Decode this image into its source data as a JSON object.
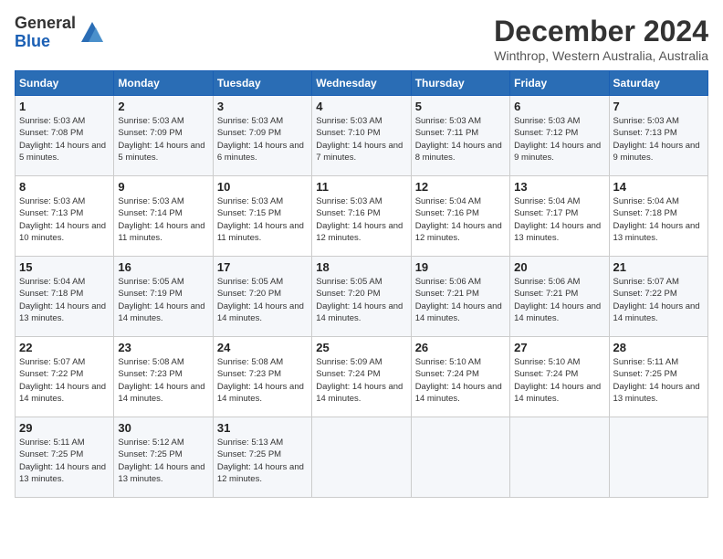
{
  "logo": {
    "general": "General",
    "blue": "Blue"
  },
  "title": "December 2024",
  "location": "Winthrop, Western Australia, Australia",
  "days_of_week": [
    "Sunday",
    "Monday",
    "Tuesday",
    "Wednesday",
    "Thursday",
    "Friday",
    "Saturday"
  ],
  "weeks": [
    [
      {
        "day": "1",
        "sunrise": "5:03 AM",
        "sunset": "7:08 PM",
        "daylight": "14 hours and 5 minutes."
      },
      {
        "day": "2",
        "sunrise": "5:03 AM",
        "sunset": "7:09 PM",
        "daylight": "14 hours and 5 minutes."
      },
      {
        "day": "3",
        "sunrise": "5:03 AM",
        "sunset": "7:09 PM",
        "daylight": "14 hours and 6 minutes."
      },
      {
        "day": "4",
        "sunrise": "5:03 AM",
        "sunset": "7:10 PM",
        "daylight": "14 hours and 7 minutes."
      },
      {
        "day": "5",
        "sunrise": "5:03 AM",
        "sunset": "7:11 PM",
        "daylight": "14 hours and 8 minutes."
      },
      {
        "day": "6",
        "sunrise": "5:03 AM",
        "sunset": "7:12 PM",
        "daylight": "14 hours and 9 minutes."
      },
      {
        "day": "7",
        "sunrise": "5:03 AM",
        "sunset": "7:13 PM",
        "daylight": "14 hours and 9 minutes."
      }
    ],
    [
      {
        "day": "8",
        "sunrise": "5:03 AM",
        "sunset": "7:13 PM",
        "daylight": "14 hours and 10 minutes."
      },
      {
        "day": "9",
        "sunrise": "5:03 AM",
        "sunset": "7:14 PM",
        "daylight": "14 hours and 11 minutes."
      },
      {
        "day": "10",
        "sunrise": "5:03 AM",
        "sunset": "7:15 PM",
        "daylight": "14 hours and 11 minutes."
      },
      {
        "day": "11",
        "sunrise": "5:03 AM",
        "sunset": "7:16 PM",
        "daylight": "14 hours and 12 minutes."
      },
      {
        "day": "12",
        "sunrise": "5:04 AM",
        "sunset": "7:16 PM",
        "daylight": "14 hours and 12 minutes."
      },
      {
        "day": "13",
        "sunrise": "5:04 AM",
        "sunset": "7:17 PM",
        "daylight": "14 hours and 13 minutes."
      },
      {
        "day": "14",
        "sunrise": "5:04 AM",
        "sunset": "7:18 PM",
        "daylight": "14 hours and 13 minutes."
      }
    ],
    [
      {
        "day": "15",
        "sunrise": "5:04 AM",
        "sunset": "7:18 PM",
        "daylight": "14 hours and 13 minutes."
      },
      {
        "day": "16",
        "sunrise": "5:05 AM",
        "sunset": "7:19 PM",
        "daylight": "14 hours and 14 minutes."
      },
      {
        "day": "17",
        "sunrise": "5:05 AM",
        "sunset": "7:20 PM",
        "daylight": "14 hours and 14 minutes."
      },
      {
        "day": "18",
        "sunrise": "5:05 AM",
        "sunset": "7:20 PM",
        "daylight": "14 hours and 14 minutes."
      },
      {
        "day": "19",
        "sunrise": "5:06 AM",
        "sunset": "7:21 PM",
        "daylight": "14 hours and 14 minutes."
      },
      {
        "day": "20",
        "sunrise": "5:06 AM",
        "sunset": "7:21 PM",
        "daylight": "14 hours and 14 minutes."
      },
      {
        "day": "21",
        "sunrise": "5:07 AM",
        "sunset": "7:22 PM",
        "daylight": "14 hours and 14 minutes."
      }
    ],
    [
      {
        "day": "22",
        "sunrise": "5:07 AM",
        "sunset": "7:22 PM",
        "daylight": "14 hours and 14 minutes."
      },
      {
        "day": "23",
        "sunrise": "5:08 AM",
        "sunset": "7:23 PM",
        "daylight": "14 hours and 14 minutes."
      },
      {
        "day": "24",
        "sunrise": "5:08 AM",
        "sunset": "7:23 PM",
        "daylight": "14 hours and 14 minutes."
      },
      {
        "day": "25",
        "sunrise": "5:09 AM",
        "sunset": "7:24 PM",
        "daylight": "14 hours and 14 minutes."
      },
      {
        "day": "26",
        "sunrise": "5:10 AM",
        "sunset": "7:24 PM",
        "daylight": "14 hours and 14 minutes."
      },
      {
        "day": "27",
        "sunrise": "5:10 AM",
        "sunset": "7:24 PM",
        "daylight": "14 hours and 14 minutes."
      },
      {
        "day": "28",
        "sunrise": "5:11 AM",
        "sunset": "7:25 PM",
        "daylight": "14 hours and 13 minutes."
      }
    ],
    [
      {
        "day": "29",
        "sunrise": "5:11 AM",
        "sunset": "7:25 PM",
        "daylight": "14 hours and 13 minutes."
      },
      {
        "day": "30",
        "sunrise": "5:12 AM",
        "sunset": "7:25 PM",
        "daylight": "14 hours and 13 minutes."
      },
      {
        "day": "31",
        "sunrise": "5:13 AM",
        "sunset": "7:25 PM",
        "daylight": "14 hours and 12 minutes."
      },
      null,
      null,
      null,
      null
    ]
  ]
}
